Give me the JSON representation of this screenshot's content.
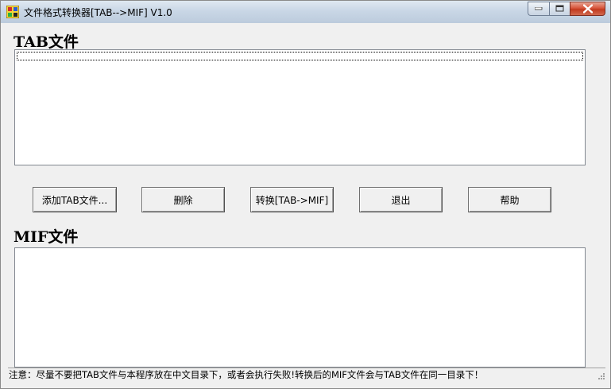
{
  "window": {
    "title": "文件格式转换器[TAB-->MIF] V1.0",
    "icon": "app-logo-icon"
  },
  "caption_buttons": {
    "minimize_icon": "minimize-icon",
    "maximize_icon": "maximize-icon",
    "close_icon": "close-icon"
  },
  "tab_section": {
    "label": "TAB文件",
    "items": []
  },
  "buttons": {
    "add": "添加TAB文件...",
    "delete": "删除",
    "convert": "转换[TAB->MIF]",
    "exit": "退出",
    "help": "帮助"
  },
  "mif_section": {
    "label": "MIF文件",
    "items": []
  },
  "status": {
    "text": "注意：尽量不要把TAB文件与本程序放在中文目录下，或者会执行失败!转换后的MIF文件会与TAB文件在同一目录下！"
  },
  "colors": {
    "window_bg": "#f0f0f0",
    "list_bg": "#ffffff",
    "close_button": "#c23a1f"
  }
}
